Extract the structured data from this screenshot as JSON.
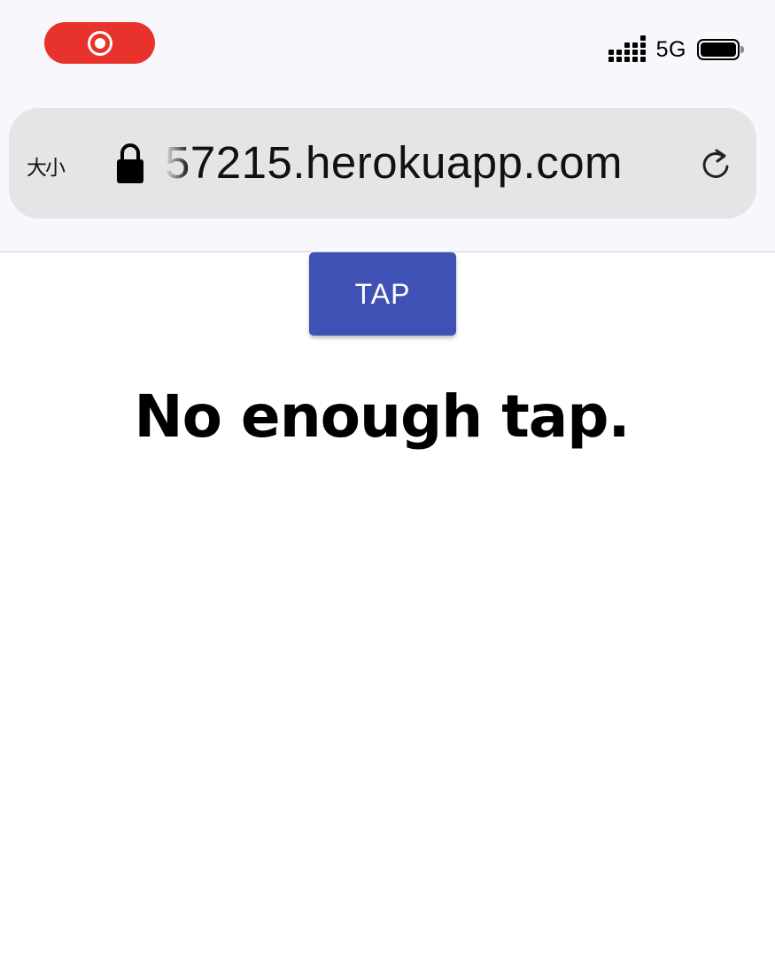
{
  "status_bar": {
    "network": "5G",
    "record_color": "#e8332c",
    "icons": [
      "record-icon",
      "signal-icon",
      "battery-icon"
    ]
  },
  "address_bar": {
    "text_size_label": "大小",
    "url": "57215.herokuapp.com",
    "icons": [
      "lock-icon",
      "reload-icon"
    ]
  },
  "main": {
    "tap_button_label": "TAP",
    "tap_button_color": "#3f51b5",
    "message": "No enough tap."
  }
}
